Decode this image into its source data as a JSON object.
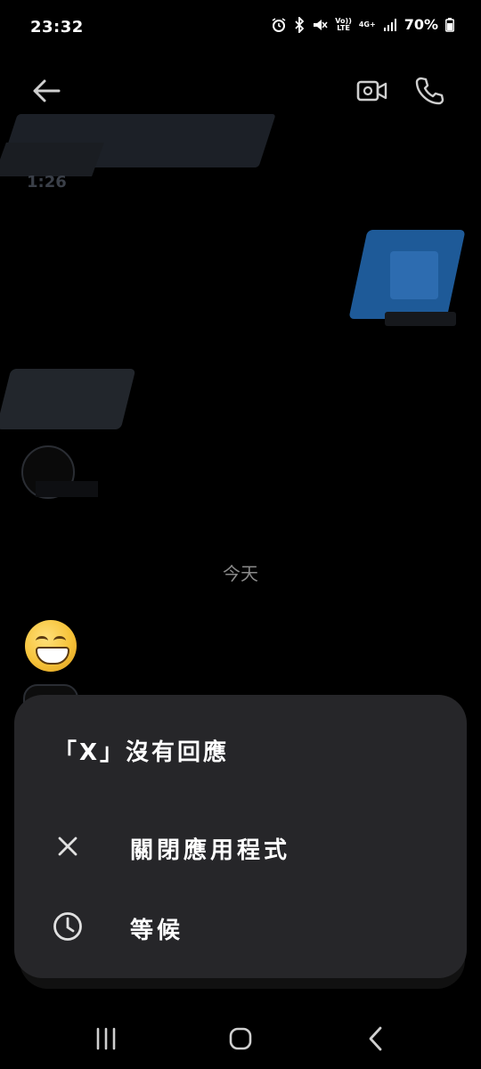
{
  "status_bar": {
    "time": "23:32",
    "lte_top": "Vo))",
    "lte_bottom": "LTE",
    "network": "4G+",
    "battery": "70%"
  },
  "header": {
    "icons": [
      "back-arrow-icon",
      "video-call-icon",
      "phone-icon"
    ],
    "contact_sub": "1:26"
  },
  "chat": {
    "date_separator": "今天",
    "emoji": "😁"
  },
  "dialog": {
    "title": "「X」沒有回應",
    "options": [
      {
        "label": "關閉應用程式",
        "icon": "close-icon"
      },
      {
        "label": "等候",
        "icon": "clock-icon"
      }
    ]
  },
  "nav": {
    "icons": [
      "recents-icon",
      "home-icon",
      "back-icon"
    ]
  },
  "colors": {
    "background": "#000000",
    "dialog_bg": "#262629",
    "text": "#ffffff",
    "muted": "#8a8a8a"
  }
}
